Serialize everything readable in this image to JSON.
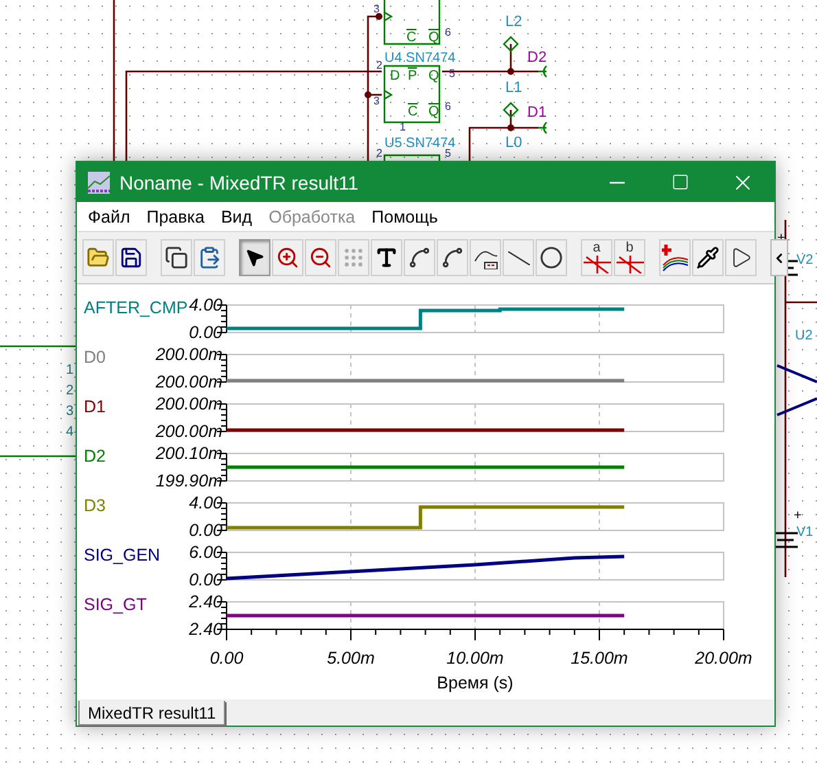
{
  "schematic": {
    "labels": [
      {
        "text": "L2",
        "color": "#2090c0"
      },
      {
        "text": "D2",
        "color": "#a000a0"
      },
      {
        "text": "L1",
        "color": "#2090c0"
      },
      {
        "text": "D1",
        "color": "#a000a0"
      },
      {
        "text": "L0",
        "color": "#2090c0"
      },
      {
        "text": "U4 SN7474",
        "color": "#2090c0"
      },
      {
        "text": "U5 SN7474",
        "color": "#2090c0"
      },
      {
        "text": "V2",
        "color": "#2090c0"
      },
      {
        "text": "U2",
        "color": "#2090c0"
      },
      {
        "text": "V1",
        "color": "#2090c0"
      },
      {
        "text": "+",
        "color": "#000000"
      },
      {
        "text": "+",
        "color": "#000000"
      }
    ],
    "pins": [
      "3",
      "6",
      "2",
      "5",
      "3",
      "6",
      "1",
      "2",
      "5",
      "1",
      "2",
      "3",
      "4"
    ],
    "chip_pins": [
      {
        "text": "C",
        "bar": true
      },
      {
        "text": "Q",
        "bar": true
      },
      {
        "text": "D",
        "bar": false
      },
      {
        "text": "P",
        "bar": true
      },
      {
        "text": "Q",
        "bar": false
      },
      {
        "text": "C",
        "bar": true
      },
      {
        "text": "Q",
        "bar": true
      }
    ]
  },
  "window": {
    "title": "Noname - MixedTR result11"
  },
  "menu": [
    {
      "label": "Файл",
      "disabled": false
    },
    {
      "label": "Правка",
      "disabled": false
    },
    {
      "label": "Вид",
      "disabled": false
    },
    {
      "label": "Обработка",
      "disabled": true
    },
    {
      "label": "Помощь",
      "disabled": false
    }
  ],
  "toolbar": [
    [
      {
        "kind": "open",
        "selected": false
      },
      {
        "kind": "save",
        "selected": false
      }
    ],
    [
      {
        "kind": "copy",
        "selected": false
      },
      {
        "kind": "paste",
        "selected": false
      }
    ],
    [
      {
        "kind": "pointer",
        "selected": true
      },
      {
        "kind": "zoom-in",
        "selected": false
      },
      {
        "kind": "zoom-out",
        "selected": false
      },
      {
        "kind": "grid",
        "selected": false
      },
      {
        "kind": "text",
        "selected": false
      },
      {
        "kind": "curve-a",
        "selected": false
      },
      {
        "kind": "curve-b",
        "selected": false
      },
      {
        "kind": "curve-c",
        "selected": false
      },
      {
        "kind": "line",
        "selected": false
      },
      {
        "kind": "circle",
        "selected": false
      }
    ],
    [
      {
        "kind": "cursor",
        "label": "a",
        "selected": false
      },
      {
        "kind": "cursor",
        "label": "b",
        "selected": false
      }
    ],
    [
      {
        "kind": "traces",
        "selected": false
      },
      {
        "kind": "probe",
        "selected": false
      },
      {
        "kind": "triangle",
        "selected": false
      }
    ]
  ],
  "traces": [
    {
      "name": "AFTER_CMP",
      "color": "#008080",
      "kind": "double-step",
      "top_label": "4.00",
      "bottom_label": "0.00"
    },
    {
      "name": "D0",
      "color": "#808080",
      "kind": "low",
      "top_label": "200.00m",
      "bottom_label": "200.00m"
    },
    {
      "name": "D1",
      "color": "#800000",
      "kind": "low",
      "top_label": "200.00m",
      "bottom_label": "200.00m"
    },
    {
      "name": "D2",
      "color": "#008000",
      "kind": "mid",
      "top_label": "200.10m",
      "bottom_label": "199.90m"
    },
    {
      "name": "D3",
      "color": "#808000",
      "kind": "step",
      "top_label": "4.00",
      "bottom_label": "0.00"
    },
    {
      "name": "SIG_GEN",
      "color": "#000080",
      "kind": "ramp",
      "top_label": "6.00",
      "bottom_label": "0.00"
    },
    {
      "name": "SIG_GT",
      "color": "#800080",
      "kind": "mid",
      "top_label": "2.40",
      "bottom_label": "2.40"
    }
  ],
  "x_axis": {
    "ticks": [
      "0.00",
      "5.00m",
      "10.00m",
      "15.00m",
      "20.00m"
    ],
    "label": "Время (s)"
  },
  "tabs": [
    {
      "label": "MixedTR result11",
      "selected": true
    }
  ]
}
